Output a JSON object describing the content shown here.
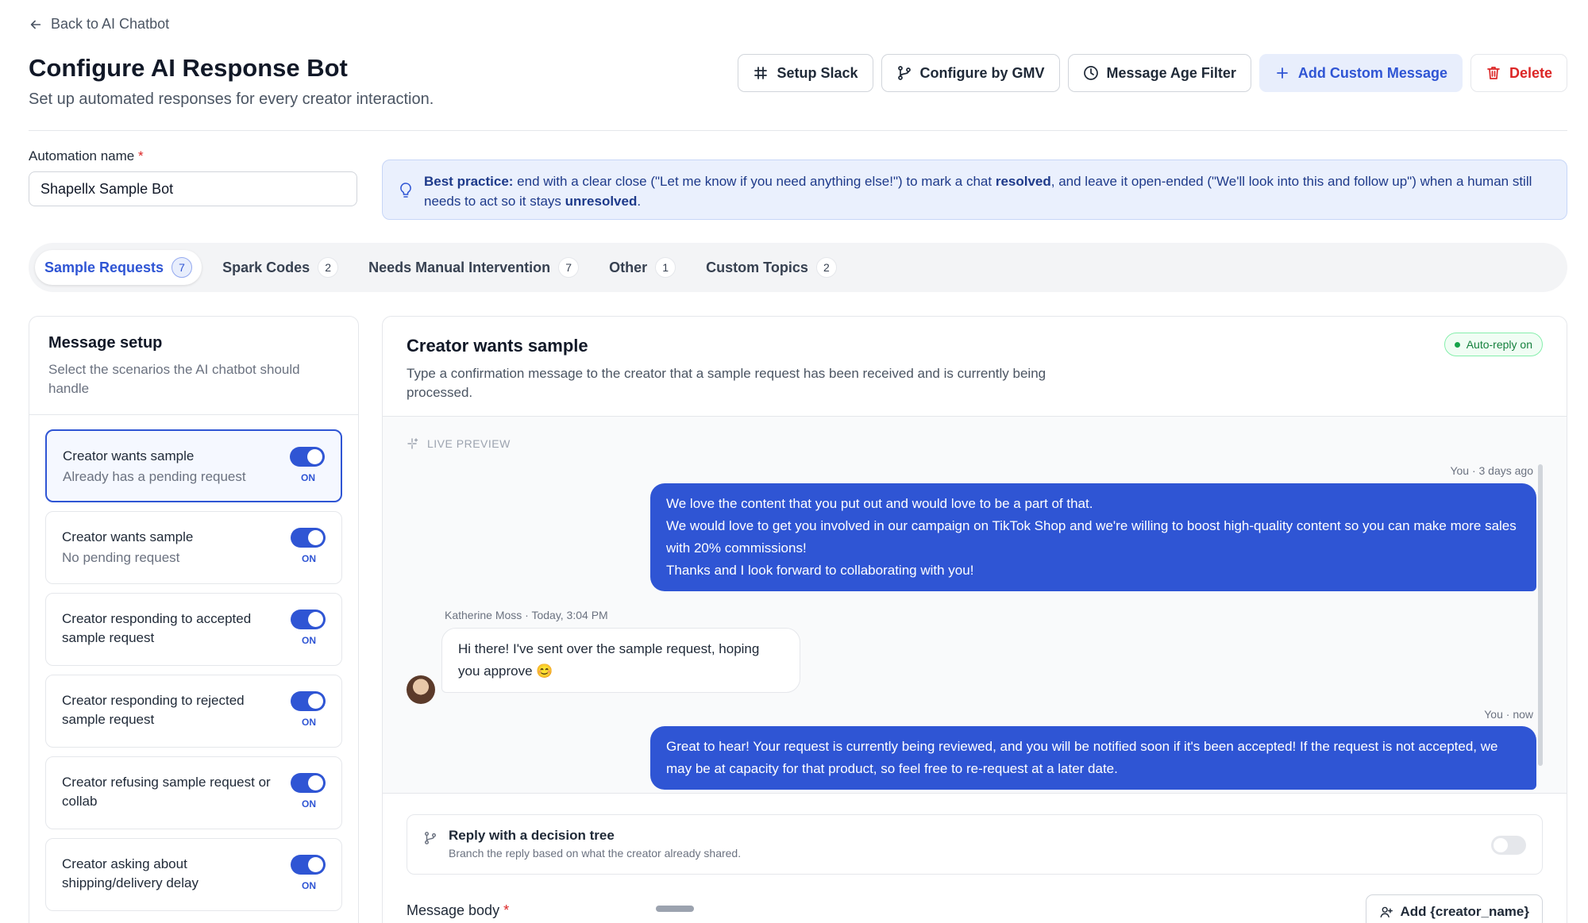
{
  "nav": {
    "back_label": "Back to AI Chatbot"
  },
  "header": {
    "title": "Configure AI Response Bot",
    "subtitle": "Set up automated responses for every creator interaction."
  },
  "actions": {
    "setup_slack": "Setup Slack",
    "configure_gmv": "Configure by GMV",
    "message_age": "Message Age Filter",
    "add_custom": "Add Custom Message",
    "delete": "Delete"
  },
  "automation": {
    "label": "Automation name",
    "required_mark": "*",
    "value": "Shapellx Sample Bot"
  },
  "tip": {
    "lead": "Best practice:",
    "part1": " end with a clear close (\"Let me know if you need anything else!\") to mark a chat ",
    "resolved": "resolved",
    "part2": ", and leave it open-ended (\"We'll look into this and follow up\") when a human still needs to act so it stays ",
    "unresolved": "unresolved",
    "end": "."
  },
  "tabs": [
    {
      "label": "Sample Requests",
      "count": "7"
    },
    {
      "label": "Spark Codes",
      "count": "2"
    },
    {
      "label": "Needs Manual Intervention",
      "count": "7"
    },
    {
      "label": "Other",
      "count": "1"
    },
    {
      "label": "Custom Topics",
      "count": "2"
    }
  ],
  "message_setup": {
    "title": "Message setup",
    "subtitle": "Select the scenarios the AI chatbot should handle",
    "on_label": "ON",
    "scenarios": [
      {
        "title": "Creator wants sample",
        "sub": "Already has a pending request"
      },
      {
        "title": "Creator wants sample",
        "sub": "No pending request"
      },
      {
        "title": "Creator responding to accepted sample request"
      },
      {
        "title": "Creator responding to rejected sample request"
      },
      {
        "title": "Creator refusing sample request or collab"
      },
      {
        "title": "Creator asking about shipping/delivery delay"
      }
    ]
  },
  "detail": {
    "title": "Creator wants sample",
    "subtitle": "Type a confirmation message to the creator that a sample request has been received and is currently being processed.",
    "badge": "Auto-reply on",
    "preview_label": "LIVE PREVIEW",
    "messages": {
      "m1_meta": "You · 3 days ago",
      "m1_lines": [
        "We love the content that you put out and would love to be a part of that.",
        "We would love to get you involved in our campaign on TikTok Shop and we're willing to boost high-quality content so you can make more sales with 20% commissions!",
        "Thanks and I look forward to collaborating with you!"
      ],
      "m2_meta": "Katherine Moss · Today, 3:04 PM",
      "m2_text": "Hi there! I've sent over the sample request, hoping you approve 😊",
      "m3_meta": "You · now",
      "m3_text": "Great to hear! Your request is currently being reviewed, and you will be notified soon if it's been accepted! If the request is not accepted, we may be at capacity for that product, so feel free to re-request at a later date."
    },
    "decision": {
      "title": "Reply with a decision tree",
      "subtitle": "Branch the reply based on what the creator already shared."
    },
    "body_label": "Message body",
    "required_mark": "*",
    "add_name": "Add {creator_name}"
  },
  "colors": {
    "accent": "#2f55d4",
    "danger": "#dc2626",
    "success": "#15803d"
  }
}
